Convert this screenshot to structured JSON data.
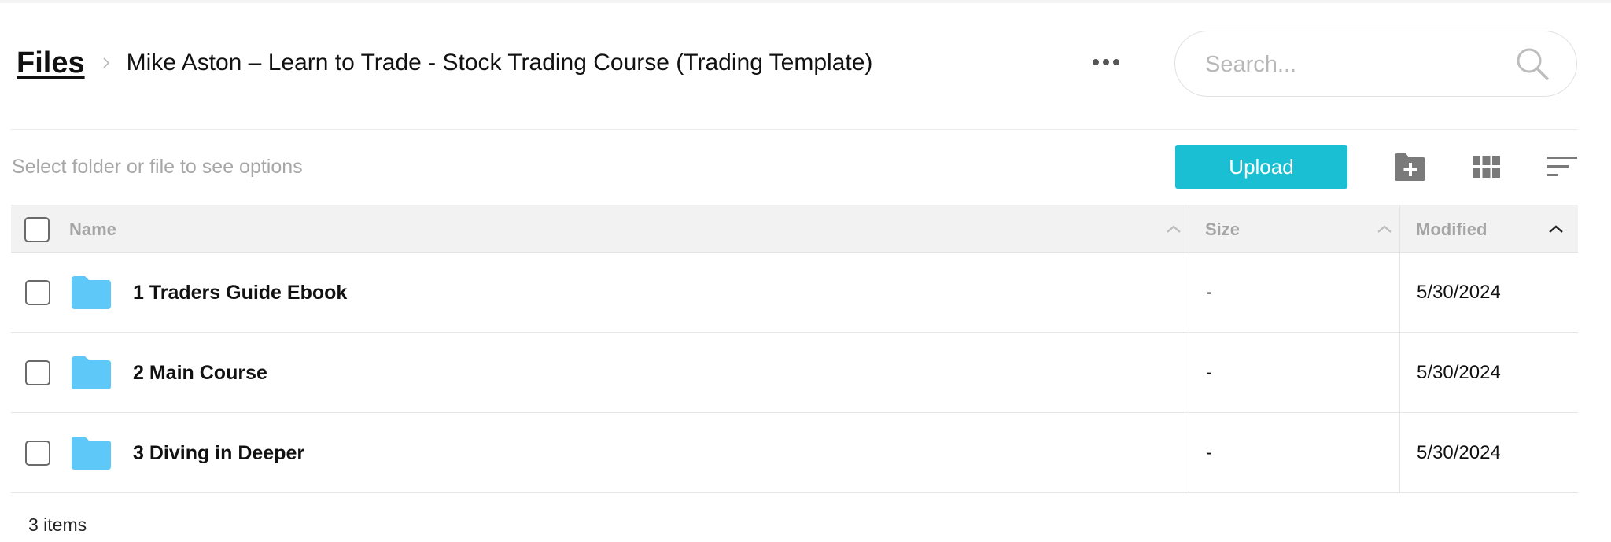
{
  "header": {
    "root_label": "Files",
    "current_folder": "Mike Aston – Learn to Trade - Stock Trading Course (Trading Template)"
  },
  "search": {
    "placeholder": "Search...",
    "value": ""
  },
  "toolbar": {
    "hint": "Select folder or file to see options",
    "upload_label": "Upload",
    "accent_color": "#1bbfd3"
  },
  "table": {
    "columns": [
      "Name",
      "Size",
      "Modified"
    ],
    "rows": [
      {
        "name": "1 Traders Guide Ebook",
        "size": "-",
        "modified": "5/30/2024",
        "icon": "folder-icon"
      },
      {
        "name": "2 Main Course",
        "size": "-",
        "modified": "5/30/2024",
        "icon": "folder-icon"
      },
      {
        "name": "3 Diving in Deeper",
        "size": "-",
        "modified": "5/30/2024",
        "icon": "folder-icon"
      }
    ],
    "folder_color": "#5ec8f8"
  },
  "footer": {
    "item_count": "3 items"
  }
}
